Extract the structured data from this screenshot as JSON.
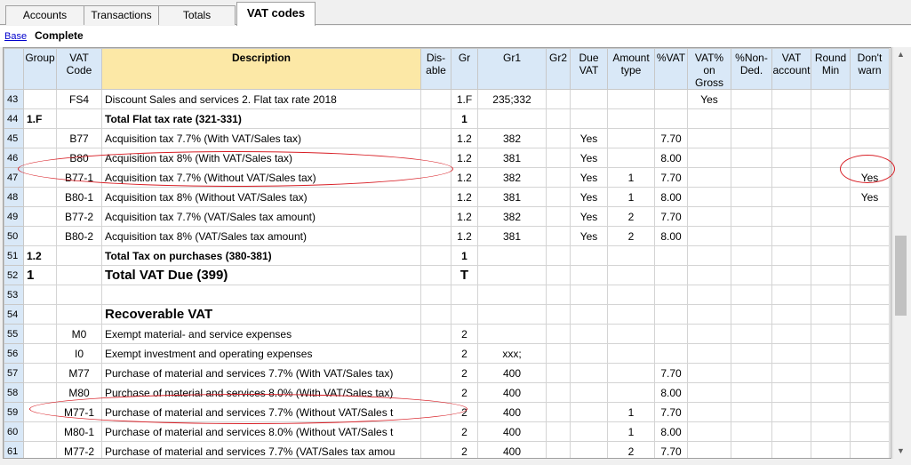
{
  "tabs": [
    {
      "label": "Accounts"
    },
    {
      "label": "Transactions"
    },
    {
      "label": "Totals"
    },
    {
      "label": "VAT codes"
    }
  ],
  "views": {
    "base": "Base",
    "complete": "Complete"
  },
  "columns": {
    "group": "Group",
    "vat_code": "VAT Code",
    "description": "Description",
    "disable": "Dis-able",
    "gr": "Gr",
    "gr1": "Gr1",
    "gr2": "Gr2",
    "due_vat": "Due VAT",
    "amount_type": "Amount type",
    "pct_vat": "%VAT",
    "vat_on_gross": "VAT% on Gross",
    "non_ded": "%Non-Ded.",
    "vat_account": "VAT account",
    "round_min": "Round Min",
    "dont_warn": "Don't warn"
  },
  "rows": [
    {
      "n": "43",
      "group": "",
      "code": "FS4",
      "desc": "Discount Sales and services 2. Flat tax rate 2018",
      "gr": "1.F",
      "gr1": "235;332",
      "due": "",
      "amt": "",
      "pct": "",
      "gross": "Yes",
      "warn": "",
      "style": ""
    },
    {
      "n": "44",
      "group": "1.F",
      "code": "",
      "desc": "Total Flat tax rate  (321-331)",
      "gr": "1",
      "gr1": "",
      "due": "",
      "amt": "",
      "pct": "",
      "gross": "",
      "warn": "",
      "style": "bold"
    },
    {
      "n": "45",
      "group": "",
      "code": "B77",
      "desc": "Acquisition tax 7.7% (With VAT/Sales tax)",
      "gr": "1.2",
      "gr1": "382",
      "due": "Yes",
      "amt": "",
      "pct": "7.70",
      "gross": "",
      "warn": "",
      "style": ""
    },
    {
      "n": "46",
      "group": "",
      "code": "B80",
      "desc": "Acquisition tax 8% (With VAT/Sales tax)",
      "gr": "1.2",
      "gr1": "381",
      "due": "Yes",
      "amt": "",
      "pct": "8.00",
      "gross": "",
      "warn": "",
      "style": ""
    },
    {
      "n": "47",
      "group": "",
      "code": "B77-1",
      "desc": "Acquisition tax 7.7% (Without VAT/Sales tax)",
      "gr": "1.2",
      "gr1": "382",
      "due": "Yes",
      "amt": "1",
      "pct": "7.70",
      "gross": "",
      "warn": "Yes",
      "style": ""
    },
    {
      "n": "48",
      "group": "",
      "code": "B80-1",
      "desc": "Acquisition tax 8% (Without VAT/Sales tax)",
      "gr": "1.2",
      "gr1": "381",
      "due": "Yes",
      "amt": "1",
      "pct": "8.00",
      "gross": "",
      "warn": "Yes",
      "style": ""
    },
    {
      "n": "49",
      "group": "",
      "code": "B77-2",
      "desc": "Acquisition tax 7.7% (VAT/Sales tax amount)",
      "gr": "1.2",
      "gr1": "382",
      "due": "Yes",
      "amt": "2",
      "pct": "7.70",
      "gross": "",
      "warn": "",
      "style": ""
    },
    {
      "n": "50",
      "group": "",
      "code": "B80-2",
      "desc": "Acquisition tax 8% (VAT/Sales tax amount)",
      "gr": "1.2",
      "gr1": "381",
      "due": "Yes",
      "amt": "2",
      "pct": "8.00",
      "gross": "",
      "warn": "",
      "style": ""
    },
    {
      "n": "51",
      "group": "1.2",
      "code": "",
      "desc": "Total Tax on purchases (380-381)",
      "gr": "1",
      "gr1": "",
      "due": "",
      "amt": "",
      "pct": "",
      "gross": "",
      "warn": "",
      "style": "bold"
    },
    {
      "n": "52",
      "group": "1",
      "code": "",
      "desc": "Total VAT Due (399)",
      "gr": "T",
      "gr1": "",
      "due": "",
      "amt": "",
      "pct": "",
      "gross": "",
      "warn": "",
      "style": "big"
    },
    {
      "n": "53",
      "group": "",
      "code": "",
      "desc": "",
      "gr": "",
      "gr1": "",
      "due": "",
      "amt": "",
      "pct": "",
      "gross": "",
      "warn": "",
      "style": ""
    },
    {
      "n": "54",
      "group": "",
      "code": "",
      "desc": "Recoverable VAT",
      "gr": "",
      "gr1": "",
      "due": "",
      "amt": "",
      "pct": "",
      "gross": "",
      "warn": "",
      "style": "big"
    },
    {
      "n": "55",
      "group": "",
      "code": "M0",
      "desc": "Exempt material- and service expenses",
      "gr": "2",
      "gr1": "",
      "due": "",
      "amt": "",
      "pct": "",
      "gross": "",
      "warn": "",
      "style": ""
    },
    {
      "n": "56",
      "group": "",
      "code": "I0",
      "desc": "Exempt investment and operating expenses",
      "gr": "2",
      "gr1": "xxx;",
      "due": "",
      "amt": "",
      "pct": "",
      "gross": "",
      "warn": "",
      "style": ""
    },
    {
      "n": "57",
      "group": "",
      "code": "M77",
      "desc": "Purchase of material and services 7.7% (With VAT/Sales tax)",
      "gr": "2",
      "gr1": "400",
      "due": "",
      "amt": "",
      "pct": "7.70",
      "gross": "",
      "warn": "",
      "style": ""
    },
    {
      "n": "58",
      "group": "",
      "code": "M80",
      "desc": "Purchase of material and services 8.0% (With VAT/Sales tax)",
      "gr": "2",
      "gr1": "400",
      "due": "",
      "amt": "",
      "pct": "8.00",
      "gross": "",
      "warn": "",
      "style": ""
    },
    {
      "n": "59",
      "group": "",
      "code": "M77-1",
      "desc": "Purchase of material and services 7.7% (Without VAT/Sales t",
      "gr": "2",
      "gr1": "400",
      "due": "",
      "amt": "1",
      "pct": "7.70",
      "gross": "",
      "warn": "",
      "style": ""
    },
    {
      "n": "60",
      "group": "",
      "code": "M80-1",
      "desc": "Purchase of material and services 8.0% (Without VAT/Sales t",
      "gr": "2",
      "gr1": "400",
      "due": "",
      "amt": "1",
      "pct": "8.00",
      "gross": "",
      "warn": "",
      "style": ""
    },
    {
      "n": "61",
      "group": "",
      "code": "M77-2",
      "desc": "Purchase of material and services 7.7% (VAT/Sales tax amou",
      "gr": "2",
      "gr1": "400",
      "due": "",
      "amt": "2",
      "pct": "7.70",
      "gross": "",
      "warn": "",
      "style": ""
    }
  ],
  "annotation_color": "#d81f26",
  "icons": {
    "scroll_up": "triangle-up-icon",
    "scroll_down": "triangle-down-icon"
  }
}
